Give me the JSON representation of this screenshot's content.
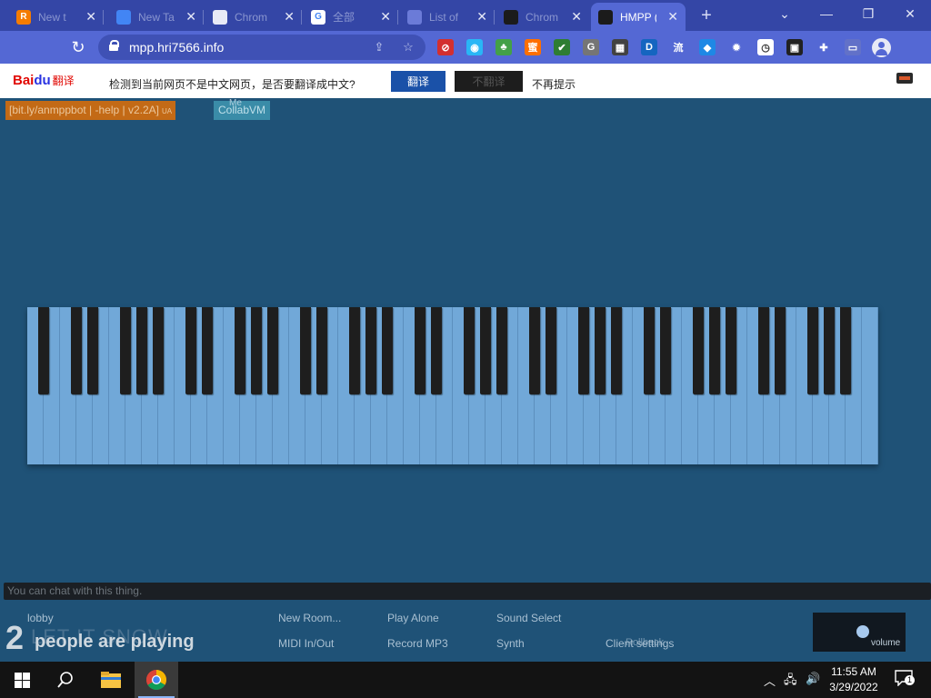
{
  "browser": {
    "tabs": [
      {
        "title": "New t",
        "favicon": "r-icon",
        "color": "#f57c00",
        "glyph": "R",
        "active": false
      },
      {
        "title": "New Ta",
        "favicon": "chrome-icon",
        "color": "#4285f4",
        "glyph": "",
        "active": false
      },
      {
        "title": "Chrom",
        "favicon": "store-icon",
        "color": "#e8eaf6",
        "glyph": "",
        "active": false
      },
      {
        "title": "全部",
        "favicon": "google-icon",
        "color": "#ffffff",
        "glyph": "G",
        "active": false
      },
      {
        "title": "List of",
        "favicon": "page-icon",
        "color": "#6b7bd8",
        "glyph": "",
        "active": false
      },
      {
        "title": "Chrom",
        "favicon": "chrome-dark-icon",
        "color": "#1b1b1b",
        "glyph": "",
        "active": false
      },
      {
        "title": "HMPP (",
        "favicon": "hmpp-icon",
        "color": "#1b1b1b",
        "glyph": "",
        "active": true
      }
    ],
    "new_tab_glyph": "+",
    "window_controls": {
      "dropdown": "⌄",
      "minimize": "—",
      "restore": "❐",
      "close": "✕"
    },
    "reload_glyph": "↻",
    "url": "mpp.hri7566.info",
    "extensions": [
      {
        "name": "stop-ext-icon",
        "color": "#d32f2f",
        "glyph": "⊘"
      },
      {
        "name": "circle-ext-icon",
        "color": "#29b6f6",
        "glyph": "◉"
      },
      {
        "name": "tree-ext-icon",
        "color": "#43a047",
        "glyph": "♣"
      },
      {
        "name": "honey-ext-icon",
        "color": "#ff6f00",
        "glyph": "蜜"
      },
      {
        "name": "check-ext-icon",
        "color": "#2e7d32",
        "glyph": "✔"
      },
      {
        "name": "grammar-ext-icon",
        "color": "#757575",
        "glyph": "G"
      },
      {
        "name": "box-ext-icon",
        "color": "#424242",
        "glyph": "▦"
      },
      {
        "name": "d-ext-icon",
        "color": "#1565c0",
        "glyph": "D"
      },
      {
        "name": "flow-ext-icon",
        "color": "#5468d4",
        "glyph": "流"
      },
      {
        "name": "shield-ext-icon",
        "color": "#1e88e5",
        "glyph": "◆"
      },
      {
        "name": "bug-ext-icon",
        "color": "#5468d4",
        "glyph": "✹"
      },
      {
        "name": "clock-ext-icon",
        "color": "#ffffff",
        "glyph": "◷"
      },
      {
        "name": "save-ext-icon",
        "color": "#212121",
        "glyph": "▣"
      },
      {
        "name": "puzzle-icon",
        "color": "#5468d4",
        "glyph": "✚"
      },
      {
        "name": "reading-list-icon",
        "color": "#6271c8",
        "glyph": "▭"
      }
    ]
  },
  "translate_bar": {
    "logo_main": "Bai",
    "logo_du": "du",
    "logo_sub": "翻译",
    "message": "检测到当前网页不是中文网页，是否要翻译成中文?",
    "translate_label": "翻译",
    "no_translate_label": "不翻译",
    "never_label": "不再提示"
  },
  "page": {
    "user_name": "[bit.ly/anmppbot | -help | v2.2A]",
    "user_badge": "UA",
    "user2_name": "CollabVM",
    "me_tag": "Me",
    "chat_placeholder": "You can chat with this thing.",
    "room_name": "lobby",
    "buttons": [
      {
        "label": "New Room...",
        "key": "new-room"
      },
      {
        "label": "Play Alone",
        "key": "play-alone"
      },
      {
        "label": "Sound Select",
        "key": "sound-select"
      },
      {
        "label": "MIDI In/Out",
        "key": "midi-in-out"
      },
      {
        "label": "Record MP3",
        "key": "record-mp3"
      },
      {
        "label": "Synth",
        "key": "synth"
      },
      {
        "label": "Client settings",
        "key": "client-settings"
      }
    ],
    "rollback_label": "Rollback",
    "ghost_text": "LET IT SNOW",
    "player_count": "2",
    "player_text": "people are playing",
    "volume_label": "volume",
    "volume_level": 0.55
  },
  "piano": {
    "white_keys": 52,
    "black_pattern": [
      1,
      0,
      1,
      1,
      0,
      1,
      1,
      1
    ]
  },
  "taskbar": {
    "time": "11:55 AM",
    "date": "3/29/2022",
    "notification_count": "1"
  }
}
